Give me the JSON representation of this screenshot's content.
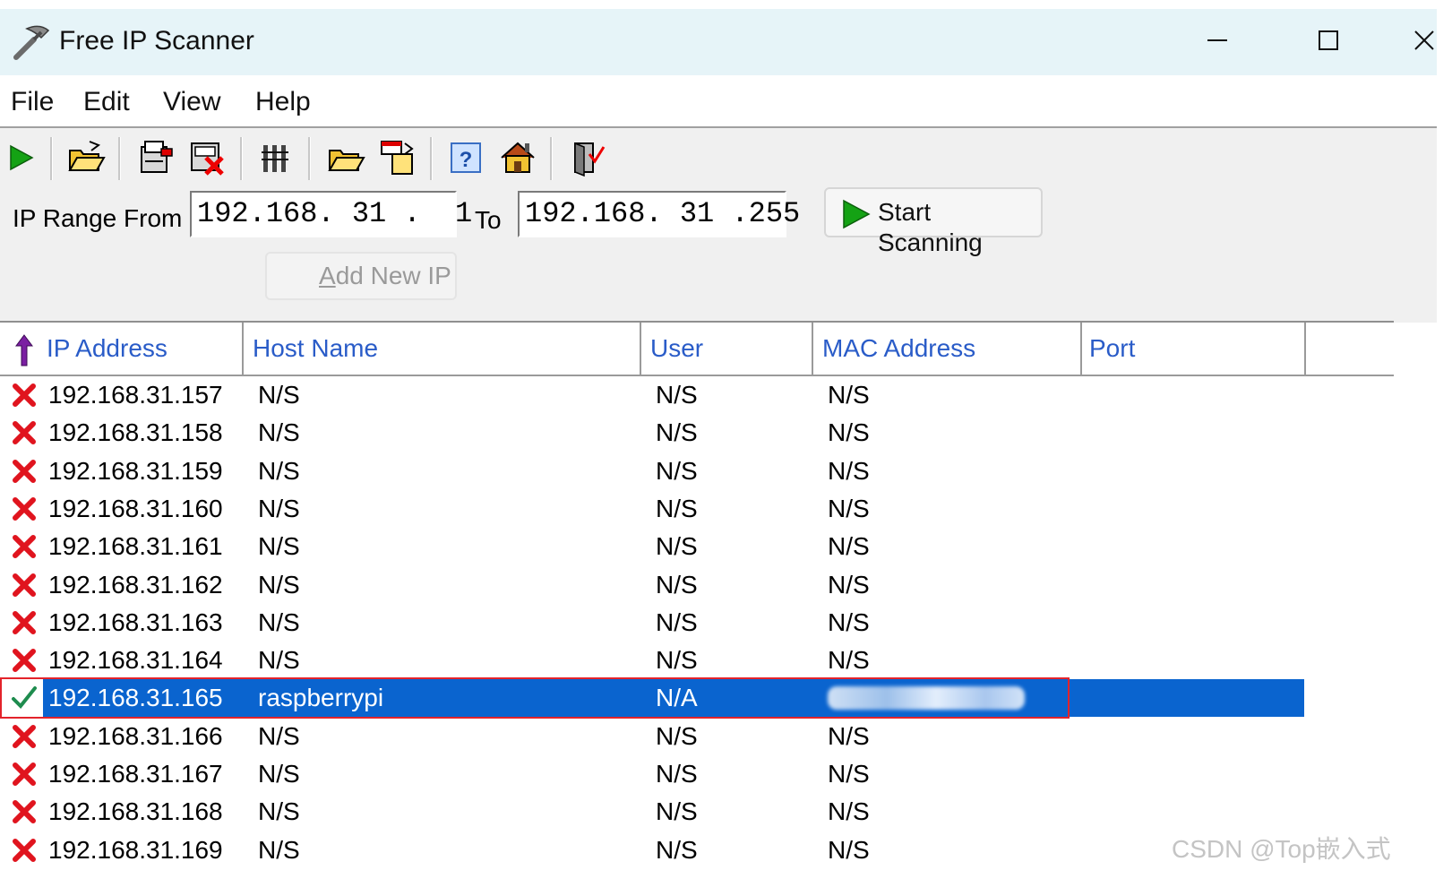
{
  "window": {
    "title": "Free IP Scanner"
  },
  "menu": {
    "items": [
      "File",
      "Edit",
      "View",
      "Help"
    ]
  },
  "toolbar": {
    "icons": [
      "play-icon",
      "open-folder-icon",
      "export-icon",
      "delete-icon",
      "columns-icon",
      "folder-icon",
      "paste-icon",
      "help-icon",
      "home-icon",
      "exit-icon"
    ]
  },
  "range": {
    "from_label": "IP Range From",
    "from_value": "192.168. 31 .  1",
    "to_label": "To",
    "to_value": "192.168. 31 .255",
    "start_label": "Start Scanning",
    "add_label_prefix": "A",
    "add_label_rest": "dd New IP"
  },
  "table": {
    "columns": [
      "IP Address",
      "Host Name",
      "User",
      "MAC Address",
      "Port"
    ],
    "rows": [
      {
        "status": "down",
        "ip": "192.168.31.157",
        "host": "N/S",
        "user": "N/S",
        "mac": "N/S",
        "port": ""
      },
      {
        "status": "down",
        "ip": "192.168.31.158",
        "host": "N/S",
        "user": "N/S",
        "mac": "N/S",
        "port": ""
      },
      {
        "status": "down",
        "ip": "192.168.31.159",
        "host": "N/S",
        "user": "N/S",
        "mac": "N/S",
        "port": ""
      },
      {
        "status": "down",
        "ip": "192.168.31.160",
        "host": "N/S",
        "user": "N/S",
        "mac": "N/S",
        "port": ""
      },
      {
        "status": "down",
        "ip": "192.168.31.161",
        "host": "N/S",
        "user": "N/S",
        "mac": "N/S",
        "port": ""
      },
      {
        "status": "down",
        "ip": "192.168.31.162",
        "host": "N/S",
        "user": "N/S",
        "mac": "N/S",
        "port": ""
      },
      {
        "status": "down",
        "ip": "192.168.31.163",
        "host": "N/S",
        "user": "N/S",
        "mac": "N/S",
        "port": ""
      },
      {
        "status": "down",
        "ip": "192.168.31.164",
        "host": "N/S",
        "user": "N/S",
        "mac": "N/S",
        "port": ""
      },
      {
        "status": "up",
        "ip": "192.168.31.165",
        "host": "raspberrypi",
        "user": "N/A",
        "mac": "",
        "port": "",
        "selected": true
      },
      {
        "status": "down",
        "ip": "192.168.31.166",
        "host": "N/S",
        "user": "N/S",
        "mac": "N/S",
        "port": ""
      },
      {
        "status": "down",
        "ip": "192.168.31.167",
        "host": "N/S",
        "user": "N/S",
        "mac": "N/S",
        "port": ""
      },
      {
        "status": "down",
        "ip": "192.168.31.168",
        "host": "N/S",
        "user": "N/S",
        "mac": "N/S",
        "port": ""
      },
      {
        "status": "down",
        "ip": "192.168.31.169",
        "host": "N/S",
        "user": "N/S",
        "mac": "N/S",
        "port": ""
      }
    ]
  },
  "watermark": "CSDN @Top嵌入式",
  "colors": {
    "accent": "#0a64cf",
    "header_text": "#2a5cc8",
    "highlight_frame": "#e3232b",
    "titlebar": "#e6f4f8"
  }
}
